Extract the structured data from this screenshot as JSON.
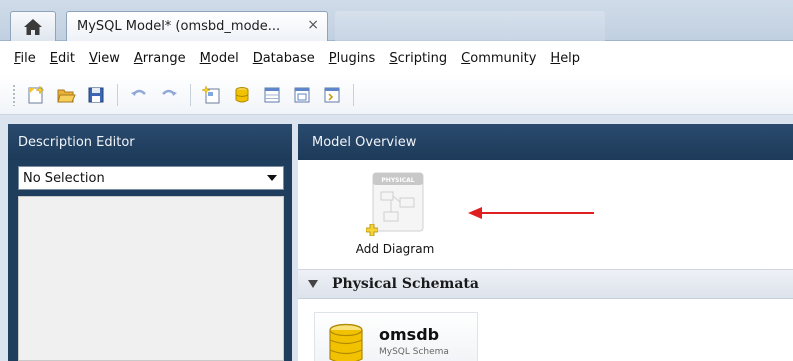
{
  "tabs": {
    "home_icon": "home-icon",
    "model_tab_title": "MySQL Model* (omsbd_mode...",
    "close_glyph": "×"
  },
  "menu": [
    {
      "underline": "F",
      "rest": "ile"
    },
    {
      "underline": "E",
      "rest": "dit"
    },
    {
      "underline": "V",
      "rest": "iew"
    },
    {
      "underline": "A",
      "rest": "rrange"
    },
    {
      "underline": "M",
      "rest": "odel"
    },
    {
      "underline": "D",
      "rest": "atabase"
    },
    {
      "underline": "P",
      "rest": "lugins"
    },
    {
      "underline": "S",
      "rest": "cripting"
    },
    {
      "underline": "C",
      "rest": "ommunity"
    },
    {
      "underline": "H",
      "rest": "elp"
    }
  ],
  "toolbar": {
    "icons": [
      "new-document-icon",
      "open-folder-icon",
      "save-icon",
      "undo-icon",
      "redo-icon",
      "add-diagram-icon",
      "add-schema-icon",
      "add-table-icon",
      "add-view-icon",
      "add-routine-icon"
    ]
  },
  "left_panel": {
    "title": "Description Editor",
    "selection": "No Selection"
  },
  "right_panel": {
    "title": "Model Overview",
    "diagram_thumb_label": "PHYSICAL",
    "add_diagram_label": "Add Diagram",
    "section_title": "Physical Schemata",
    "schema": {
      "name": "omsdb",
      "subtitle": "MySQL Schema"
    }
  },
  "colors": {
    "panel_header": "#1f3d5c",
    "arrow": "#e02020",
    "schema_icon": "#f2c200"
  }
}
